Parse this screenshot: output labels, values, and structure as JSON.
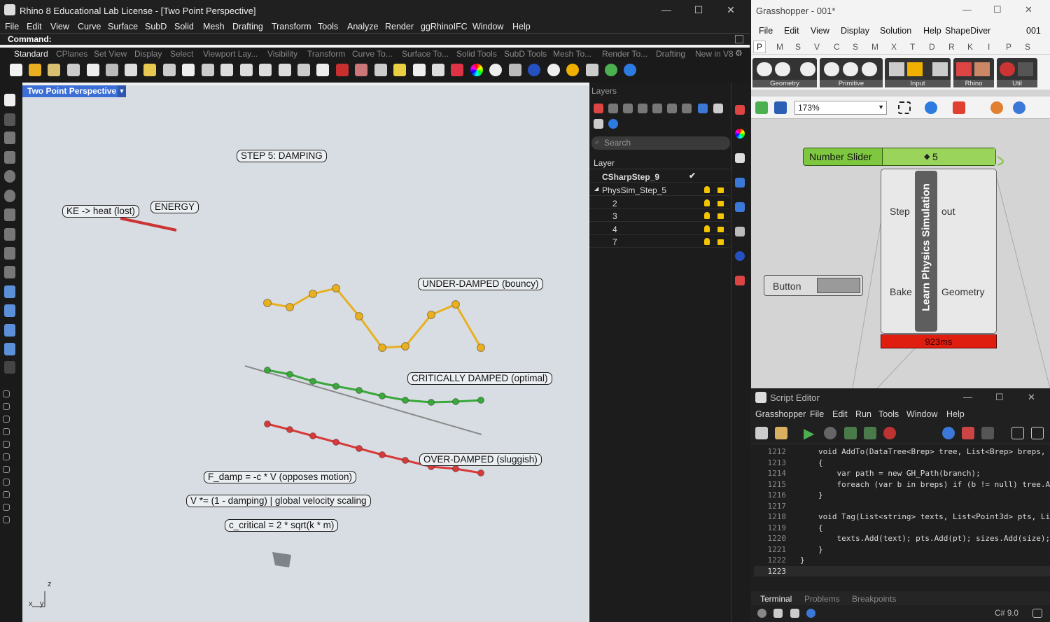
{
  "rhino": {
    "title": "Rhino 8 Educational Lab License - [Two Point Perspective]",
    "menu": [
      "File",
      "Edit",
      "View",
      "Curve",
      "Surface",
      "SubD",
      "Solid",
      "Mesh",
      "Drafting",
      "Transform",
      "Tools",
      "Analyze",
      "Render",
      "ggRhinoIFC",
      "Window",
      "Help"
    ],
    "command_label": "Command:",
    "toolbar_tabs": [
      "Standard",
      "CPlanes",
      "Set View",
      "Display",
      "Select",
      "Viewport Lay...",
      "Visibility",
      "Transform",
      "Curve To...",
      "Surface To...",
      "Solid Tools",
      "SubD Tools",
      "Mesh To...",
      "Render To...",
      "Drafting",
      "New in V8"
    ],
    "viewport": {
      "title": "Two Point Perspective",
      "labels": {
        "step": "STEP 5: DAMPING",
        "energy": "ENERGY",
        "ke": "KE -> heat (lost)",
        "under": "UNDER-DAMPED (bouncy)",
        "critical": "CRITICALLY DAMPED (optimal)",
        "over": "OVER-DAMPED (sluggish)",
        "fdamp": "F_damp = -c * V  (opposes motion)",
        "vscale": "V *= (1 - damping)  |  global velocity scaling",
        "ccrit": "c_critical = 2 * sqrt(k * m)"
      },
      "axis_labels": {
        "x": "x",
        "y": "y",
        "z": "z"
      },
      "colors": {
        "under": "#e8b020",
        "critical": "#3aa83a",
        "over": "#d83a3a",
        "energy": "#cc3333"
      }
    }
  },
  "layers": {
    "header": "Layers",
    "search_placeholder": "Search",
    "column_header": "Layer",
    "rows": [
      {
        "name": "CSharpStep_9",
        "current": true
      },
      {
        "name": "PhysSim_Step_5",
        "expanded": true
      },
      {
        "name": "2"
      },
      {
        "name": "3"
      },
      {
        "name": "4"
      },
      {
        "name": "7"
      }
    ]
  },
  "grasshopper": {
    "title": "Grasshopper - 001*",
    "menu": [
      "File",
      "Edit",
      "View",
      "Display",
      "Solution",
      "Help",
      "ShapeDiver"
    ],
    "doc_name": "001",
    "tabs": [
      "P",
      "M",
      "S",
      "V",
      "C",
      "S",
      "M",
      "X",
      "T",
      "D",
      "R",
      "K",
      "I",
      "P",
      "S"
    ],
    "groups": [
      "Geometry",
      "Primitive",
      "Input",
      "Rhino",
      "Util"
    ],
    "zoom": "173%",
    "canvas": {
      "slider_label": "Number Slider",
      "slider_value": "5",
      "component_name": "Learn Physics Simulation",
      "inputs": [
        "Step",
        "Bake"
      ],
      "outputs": [
        "out",
        "Geometry"
      ],
      "button_label": "Button",
      "timing": "923ms"
    }
  },
  "script_editor": {
    "title": "Script Editor",
    "menu": [
      "Grasshopper",
      "File",
      "Edit",
      "Run",
      "Tools",
      "Window",
      "Help"
    ],
    "lines": [
      {
        "n": "1212",
        "code": "void AddTo(DataTree<Brep> tree, List<Brep> breps, i"
      },
      {
        "n": "1213",
        "code": "{"
      },
      {
        "n": "1214",
        "code": "    var path = new GH_Path(branch);"
      },
      {
        "n": "1215",
        "code": "    foreach (var b in breps) if (b != null) tree.Ad"
      },
      {
        "n": "1216",
        "code": "}"
      },
      {
        "n": "1217",
        "code": ""
      },
      {
        "n": "1218",
        "code": "void Tag(List<string> texts, List<Point3d> pts, Lis"
      },
      {
        "n": "1219",
        "code": "{"
      },
      {
        "n": "1220",
        "code": "    texts.Add(text); pts.Add(pt); sizes.Add(size);"
      },
      {
        "n": "1221",
        "code": "}"
      },
      {
        "n": "1222",
        "code": "}"
      },
      {
        "n": "1223",
        "code": ""
      }
    ],
    "bottom_tabs": [
      "Terminal",
      "Problems",
      "Breakpoints"
    ],
    "language": "C# 9.0"
  }
}
